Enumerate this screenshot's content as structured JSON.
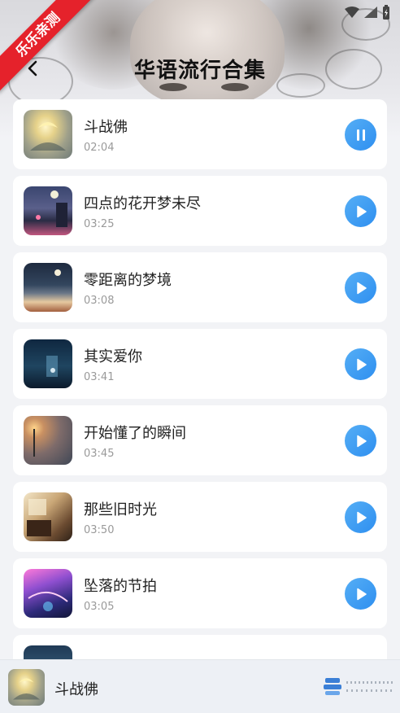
{
  "ribbon": {
    "text": "乐乐亲测"
  },
  "header": {
    "title": "华语流行合集"
  },
  "songs": [
    {
      "name": "斗战佛",
      "duration": "02:04",
      "state": "playing",
      "icon": "pause-icon"
    },
    {
      "name": "四点的花开梦未尽",
      "duration": "03:25",
      "state": "paused",
      "icon": "play-icon"
    },
    {
      "name": "零距离的梦境",
      "duration": "03:08",
      "state": "paused",
      "icon": "play-icon"
    },
    {
      "name": "其实爱你",
      "duration": "03:41",
      "state": "paused",
      "icon": "play-icon"
    },
    {
      "name": "开始懂了的瞬间",
      "duration": "03:45",
      "state": "paused",
      "icon": "play-icon"
    },
    {
      "name": "那些旧时光",
      "duration": "03:50",
      "state": "paused",
      "icon": "play-icon"
    },
    {
      "name": "坠落的节拍",
      "duration": "03:05",
      "state": "paused",
      "icon": "play-icon"
    }
  ],
  "player": {
    "title": "斗战佛"
  },
  "colors": {
    "accent": "#3b95f2",
    "ribbon": "#e5222b",
    "background": "#f2f3f6"
  }
}
